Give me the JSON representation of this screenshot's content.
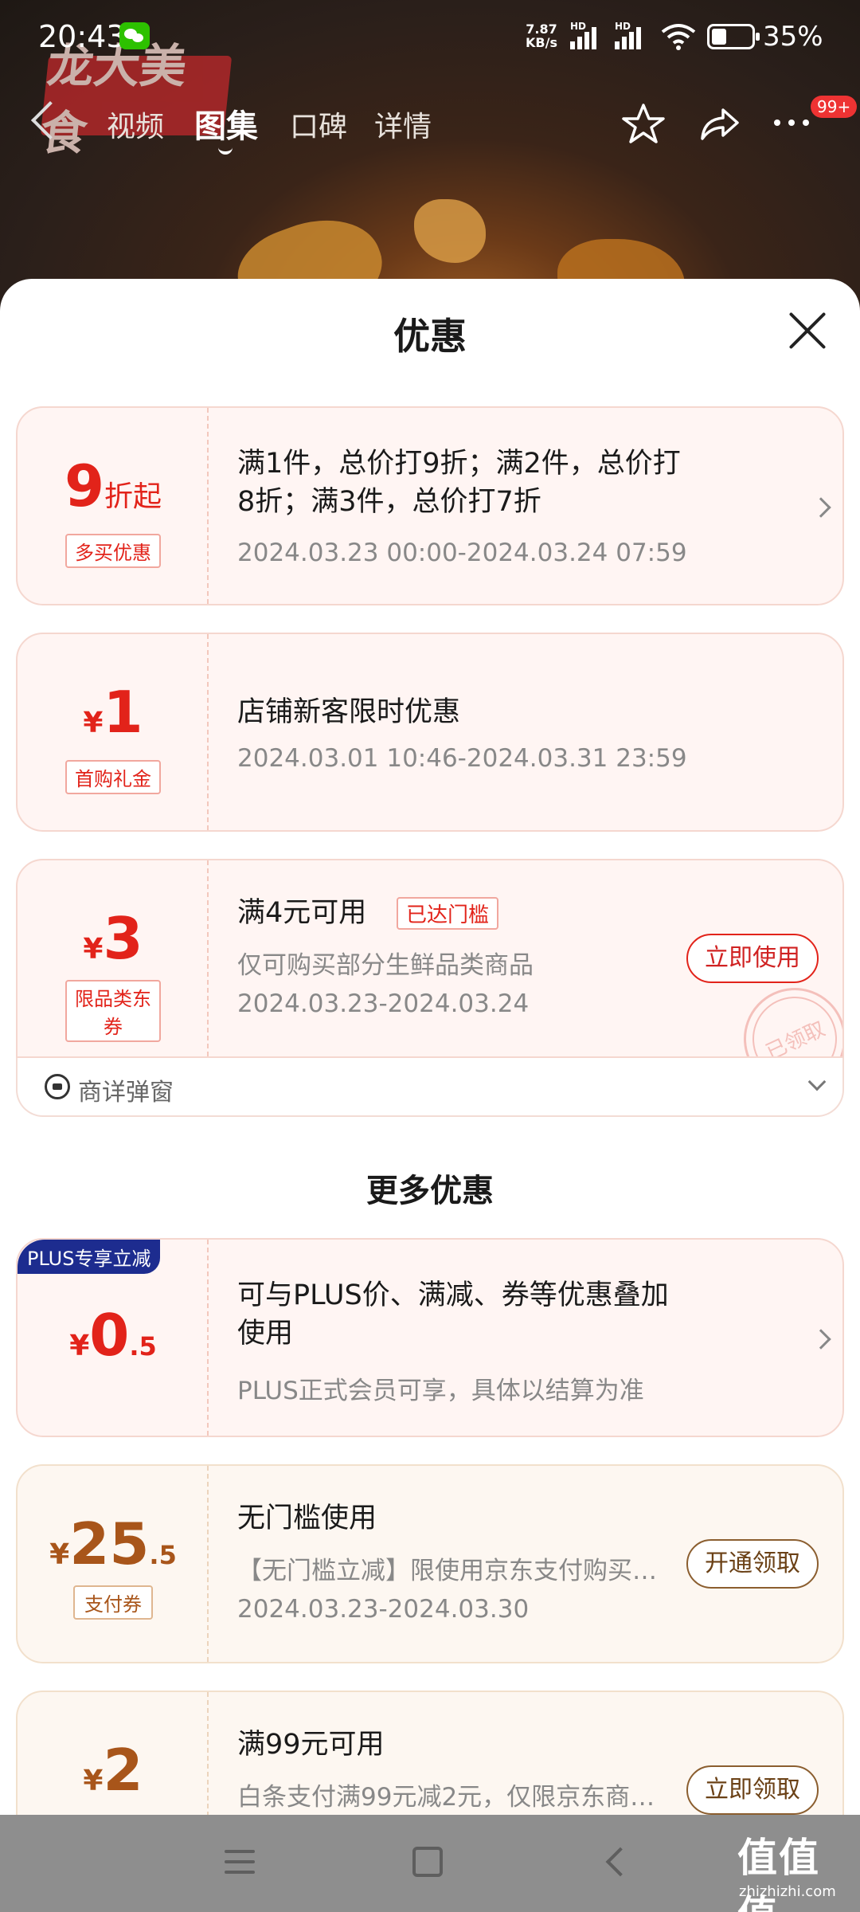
{
  "status_bar": {
    "time": "20:43",
    "net_speed_value": "7.87",
    "net_speed_unit": "KB/s",
    "signal_tag": "HD",
    "battery": "35%"
  },
  "header": {
    "brand_logo_text": "龙大美食",
    "tabs": [
      {
        "label": "视频"
      },
      {
        "label": "图集"
      },
      {
        "label": "口碑"
      },
      {
        "label": "详情"
      }
    ],
    "active_tab": "图集",
    "notification_badge": "99+"
  },
  "sheet": {
    "title": "优惠",
    "offers": [
      {
        "amount": "9",
        "amount_suffix": "折起",
        "tag": "多买优惠",
        "line1": "满1件，总价打9折；满2件，总价打",
        "line1b": "8折；满3件，总价打7折",
        "line2": "2024.03.23 00:00-2024.03.24 07:59"
      },
      {
        "currency": "¥",
        "amount": "1",
        "tag": "首购礼金",
        "line1": "店铺新客限时优惠",
        "line2": "2024.03.01 10:46-2024.03.31 23:59"
      },
      {
        "currency": "¥",
        "amount": "3",
        "tag": "限品类东券",
        "line1": "满4元可用",
        "badge": "已达门槛",
        "line2": "仅可购买部分生鲜品类商品",
        "line3": "2024.03.23-2024.03.24",
        "button": "立即使用",
        "stamp": "已领取",
        "detail_label": "商详弹窗"
      }
    ],
    "more_title": "更多优惠",
    "more_offers": [
      {
        "corner_badge": "PLUS专享立减",
        "currency": "¥",
        "amount": "0",
        "decimal": ".5",
        "line1": "可与PLUS价、满减、券等优惠叠加",
        "line1b": "使用",
        "line2": "PLUS正式会员可享，具体以结算为准"
      },
      {
        "currency": "¥",
        "amount": "25",
        "decimal": ".5",
        "tag": "支付券",
        "line1": "无门槛使用",
        "line2": "【无门槛立减】限使用京东支付购买…",
        "line3": "2024.03.23-2024.03.30",
        "button": "开通领取"
      },
      {
        "currency": "¥",
        "amount": "2",
        "line1": "满99元可用",
        "line2": "白条支付满99元减2元，仅限京东商…",
        "button": "立即领取"
      }
    ]
  },
  "watermark": {
    "text": "值值值",
    "sub": "zhizhizhi.com"
  },
  "colors": {
    "accent_red": "#e2231a",
    "gold_brown": "#a8551a",
    "plus_blue": "#1d2c8f"
  }
}
